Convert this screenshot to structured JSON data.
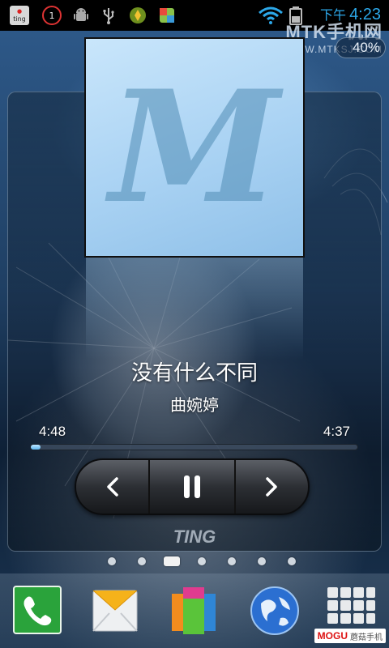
{
  "status_bar": {
    "ting_label": "ting",
    "notification_count": "1",
    "time_prefix": "下午",
    "time": "4:23",
    "battery_percent": "40%"
  },
  "watermark": {
    "main": "MTK手机网",
    "url": "WWW.MTKSJ.COM"
  },
  "player": {
    "song_title": "没有什么不同",
    "artist": "曲婉婷",
    "elapsed": "4:48",
    "total": "4:37",
    "progress_fraction": 0.03,
    "brand": "TING",
    "album_letter": "M"
  },
  "pager": {
    "pages": 7,
    "active": 2
  },
  "dock": {
    "items": [
      "phone-icon",
      "messaging-icon",
      "app-drawer-icon",
      "browser-icon",
      "all-apps-icon"
    ],
    "badge_en": "MOGU",
    "badge_cn": "蘑菇手机"
  }
}
